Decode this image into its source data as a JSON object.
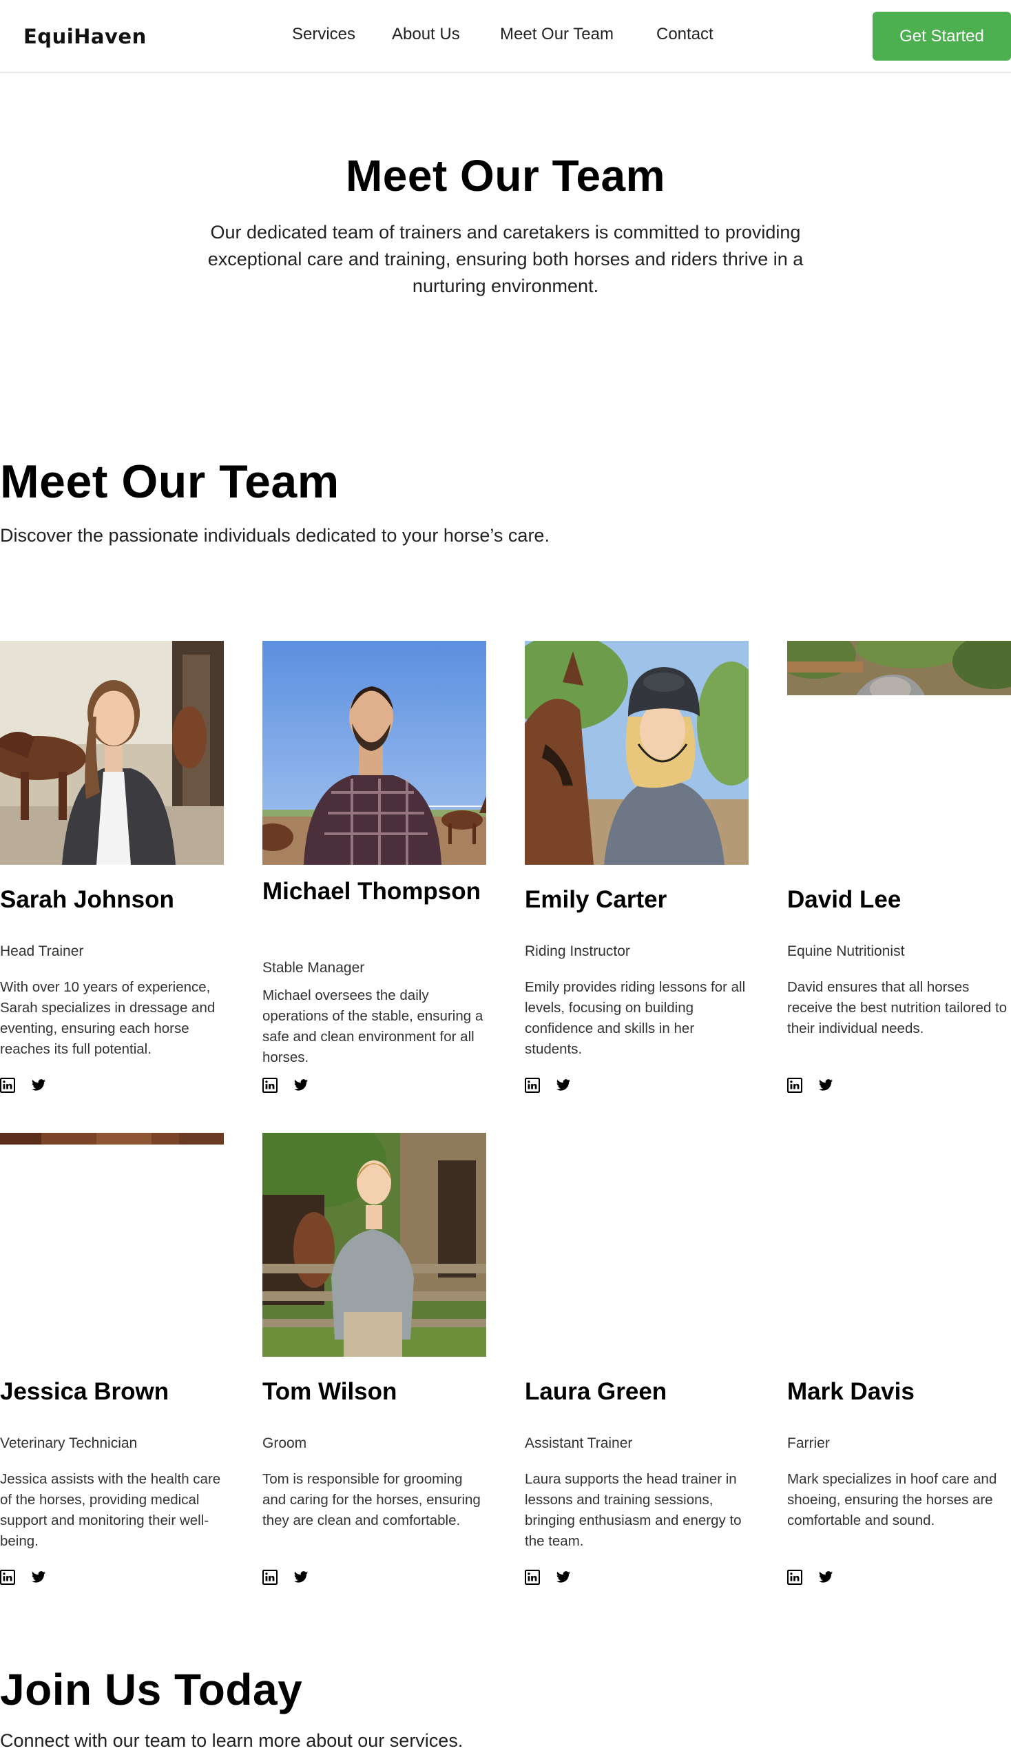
{
  "header": {
    "logo": "EquiHaven",
    "nav": [
      "Services",
      "About Us",
      "Meet Our Team",
      "Contact"
    ],
    "cta": "Get Started"
  },
  "hero": {
    "title": "Meet Our Team",
    "subtitle": "Our dedicated team of trainers and caretakers is committed to providing exceptional care and training, ensuring both horses and riders thrive in a nurturing environment."
  },
  "team": {
    "title": "Meet Our Team",
    "subtitle": "Discover the passionate individuals dedicated to your horse’s care.",
    "members": [
      {
        "name": "Sarah Johnson",
        "role": "Head Trainer",
        "bio": "With over 10 years of experience, Sarah specializes in dressage and eventing, ensuring each horse reaches its full potential."
      },
      {
        "name": "Michael Thompson",
        "role": "Stable Manager",
        "bio": "Michael oversees the daily operations of the stable, ensuring a safe and clean environment for all horses."
      },
      {
        "name": "Emily Carter",
        "role": "Riding Instructor",
        "bio": "Emily provides riding lessons for all levels, focusing on building confidence and skills in her students."
      },
      {
        "name": "David Lee",
        "role": "Equine Nutritionist",
        "bio": "David ensures that all horses receive the best nutrition tailored to their individual needs."
      },
      {
        "name": "Jessica Brown",
        "role": "Veterinary Technician",
        "bio": "Jessica assists with the health care of the horses, providing medical support and monitoring their well-being."
      },
      {
        "name": "Tom Wilson",
        "role": "Groom",
        "bio": "Tom is responsible for grooming and caring for the horses, ensuring they are clean and comfortable."
      },
      {
        "name": "Laura Green",
        "role": "Assistant Trainer",
        "bio": "Laura supports the head trainer in lessons and training sessions, bringing enthusiasm and energy to the team."
      },
      {
        "name": "Mark Davis",
        "role": "Farrier",
        "bio": "Mark specializes in hoof care and shoeing, ensuring the horses are comfortable and sound."
      }
    ],
    "social_icons": [
      "linkedin-icon",
      "twitter-icon"
    ]
  },
  "join": {
    "title": "Join Us Today",
    "subtitle": "Connect with our team to learn more about our services."
  },
  "colors": {
    "accent": "#4caf50",
    "text": "#111111",
    "border": "#e6e6e6"
  }
}
